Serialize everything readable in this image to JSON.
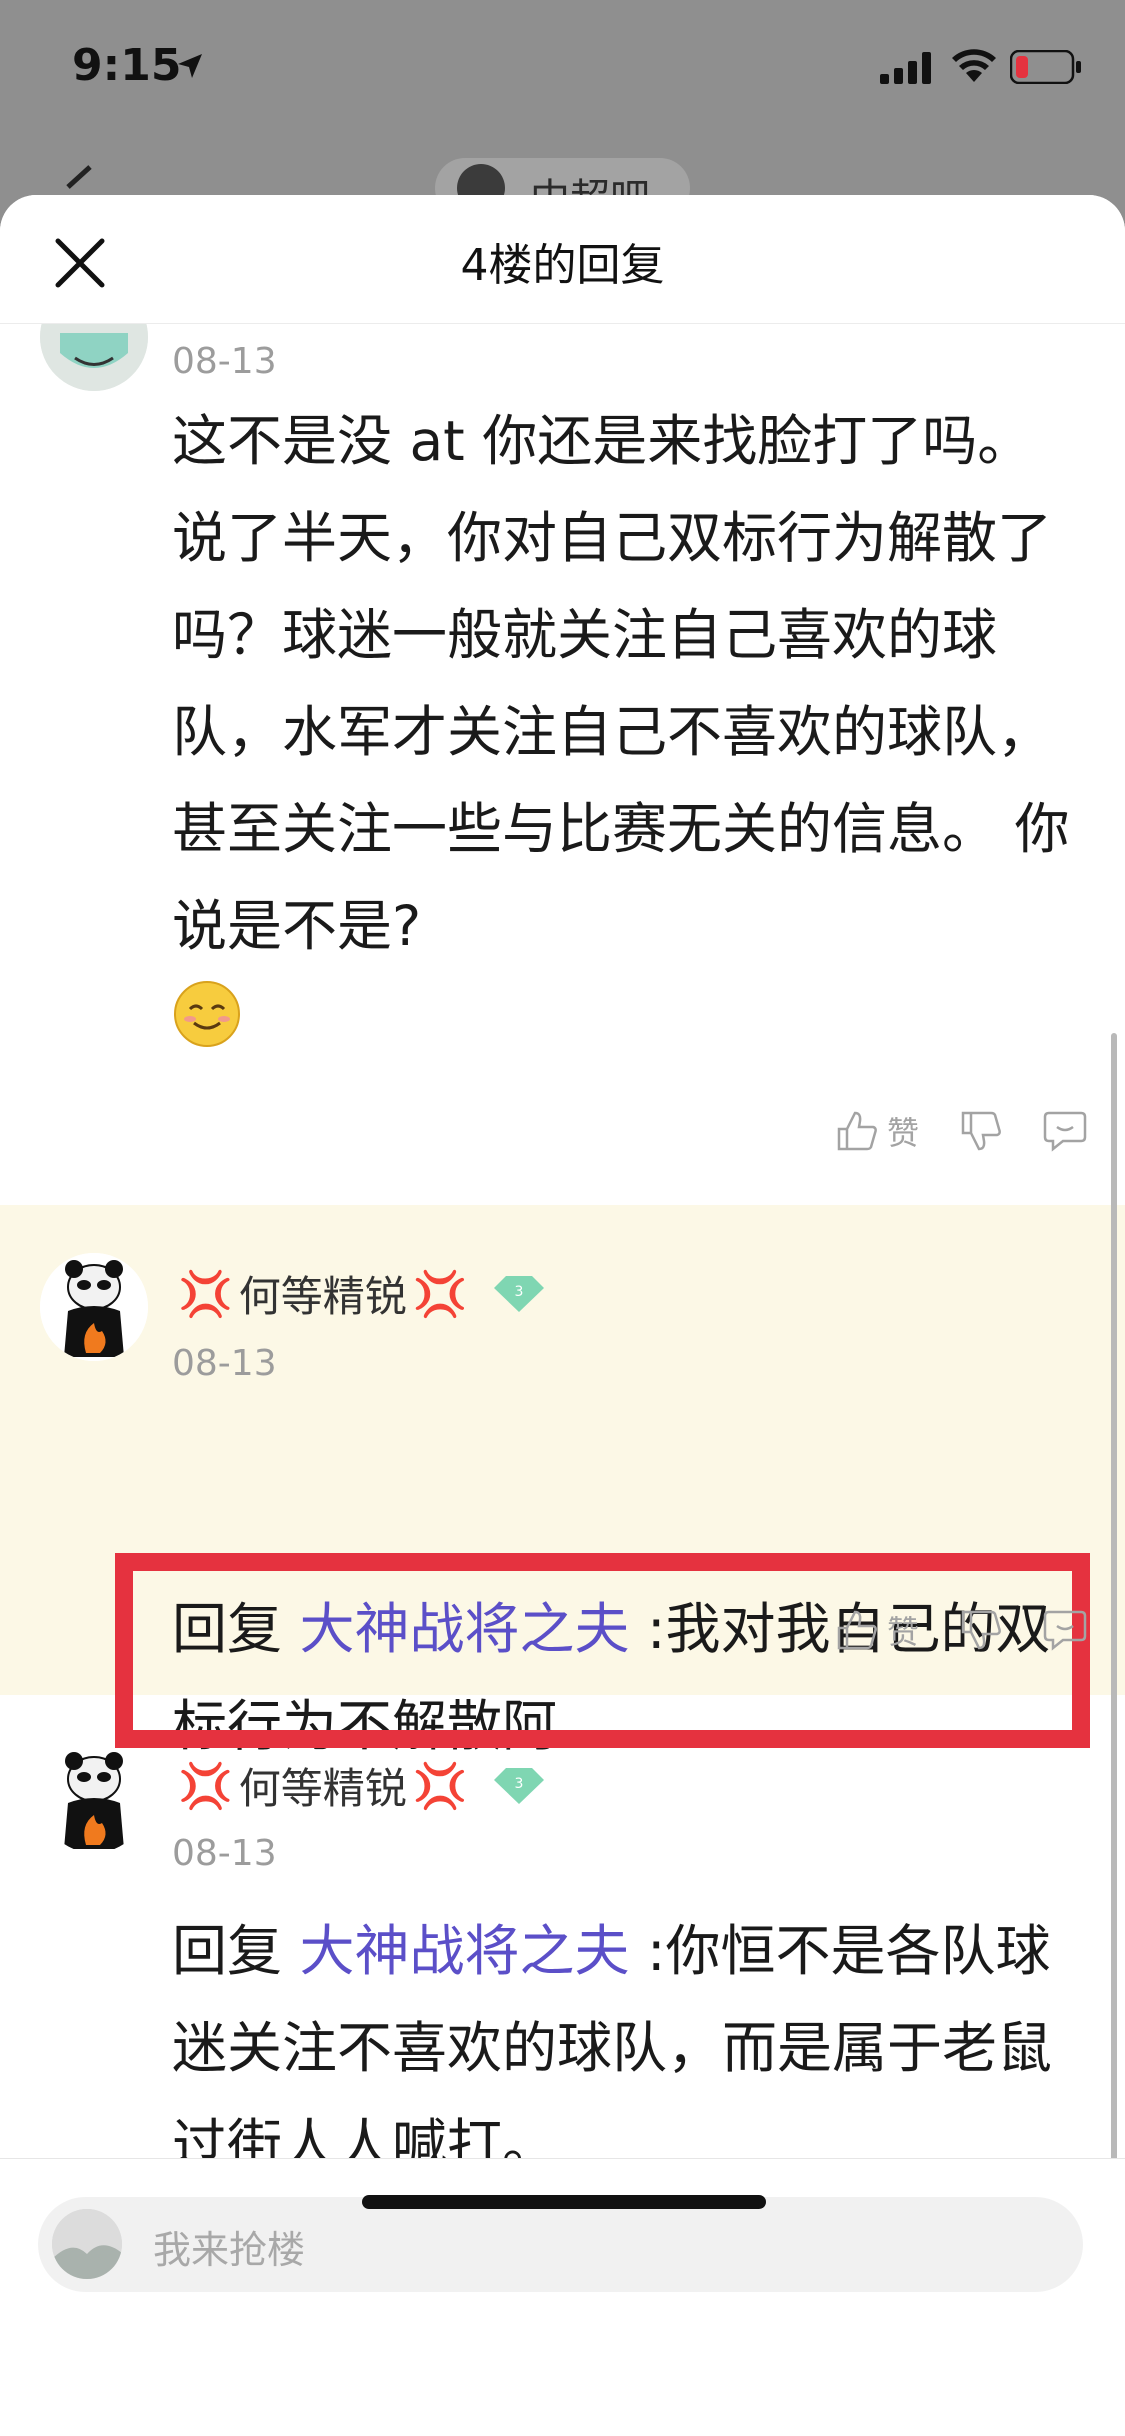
{
  "status_bar": {
    "time": "9:15"
  },
  "background_page": {
    "title": "中超吧"
  },
  "sheet": {
    "title": "4楼的回复"
  },
  "comments": [
    {
      "date": "08-13",
      "text": "这不是没 at 你还是来找脸打了吗。说了半天，你对自己双标行为解散了吗？球迷一般就关注自己喜欢的球队，水军才关注自己不喜欢的球队，甚至关注一些与比赛无关的信息。 你说是不是?",
      "like_label": "赞"
    },
    {
      "username": "何等精锐",
      "anger_left": "💢",
      "anger_right": "💢",
      "level": "3",
      "date": "08-13",
      "reply_prefix": "回复 ",
      "reply_to": "大神战将之夫",
      "text": " :我对我自己的双标行为不解散阿",
      "like_label": "赞"
    },
    {
      "username": "何等精锐",
      "anger_left": "💢",
      "anger_right": "💢",
      "level": "3",
      "date": "08-13",
      "reply_prefix": "回复 ",
      "reply_to": "大神战将之夫",
      "text": " :你恒不是各队球迷关注不喜欢的球队，而是属于老鼠过街人人喊打。"
    }
  ],
  "input": {
    "placeholder": "我来抢楼"
  },
  "colors": {
    "highlight_bg": "#fcf8e6",
    "red_box": "#e5323f",
    "link": "#5b4fc8"
  }
}
